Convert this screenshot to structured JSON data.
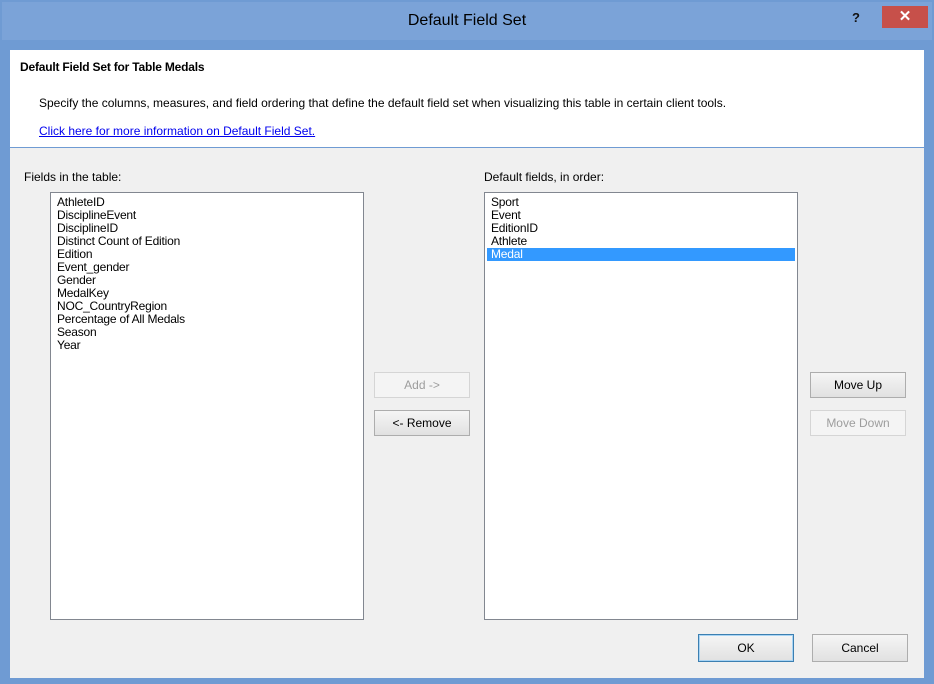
{
  "window": {
    "title": "Default Field Set",
    "help_glyph": "?",
    "close_glyph": "✕"
  },
  "header": {
    "title": "Default Field Set for Table Medals",
    "description": "Specify the columns, measures, and field ordering that define the default field set when visualizing this table in certain client tools.",
    "link": "Click here for more information on Default Field Set."
  },
  "fields_list": {
    "label": "Fields in the table:",
    "items": [
      "AthleteID",
      "DisciplineEvent",
      "DisciplineID",
      "Distinct Count of Edition",
      "Edition",
      "Event_gender",
      "Gender",
      "MedalKey",
      "NOC_CountryRegion",
      "Percentage of All Medals",
      "Season",
      "Year"
    ]
  },
  "default_list": {
    "label": "Default fields, in order:",
    "items": [
      "Sport",
      "Event",
      "EditionID",
      "Athlete",
      "Medal"
    ],
    "selected": "Medal"
  },
  "buttons": {
    "add": "Add ->",
    "remove": "<- Remove",
    "move_up": "Move Up",
    "move_down": "Move Down",
    "ok": "OK",
    "cancel": "Cancel"
  }
}
